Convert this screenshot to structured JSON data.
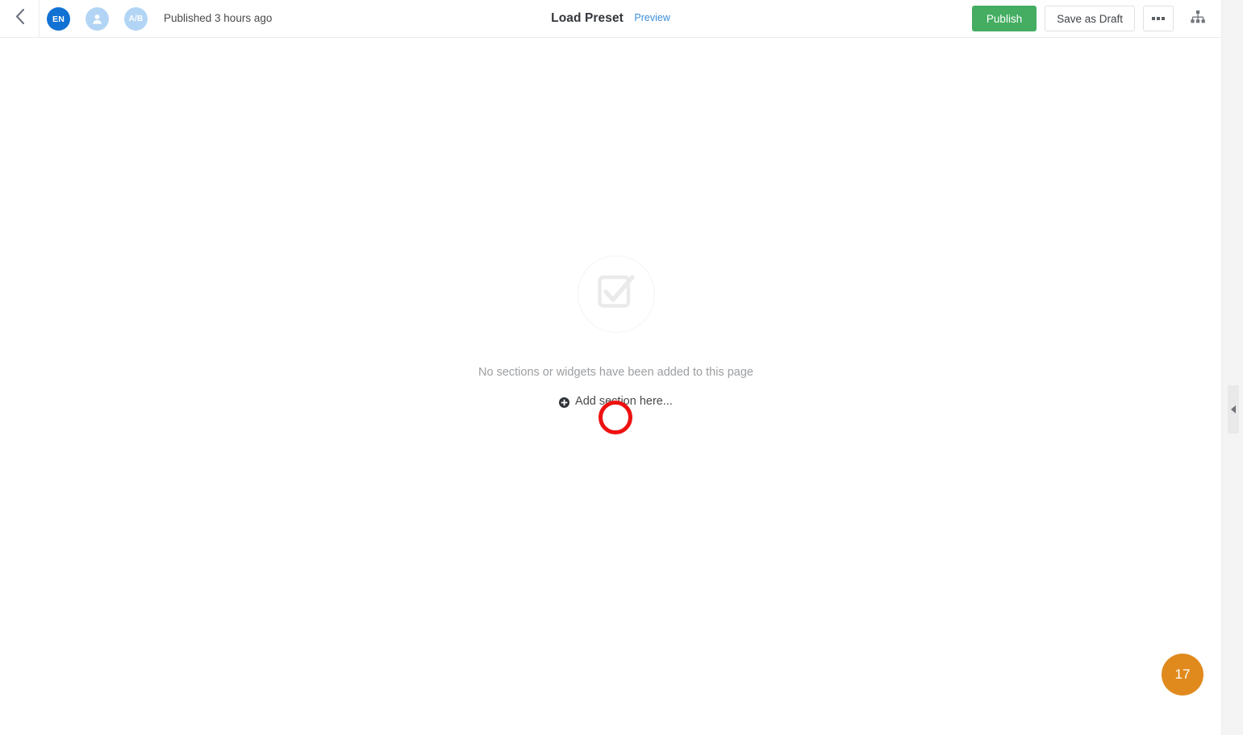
{
  "header": {
    "back_icon": "chevron-left-icon",
    "avatars": [
      {
        "name": "language-avatar",
        "label": "EN",
        "kind": "text"
      },
      {
        "name": "visitor-avatar",
        "label": "",
        "kind": "person-icon"
      },
      {
        "name": "ab-test-avatar",
        "label": "A/B",
        "kind": "text"
      }
    ],
    "status_text": "Published 3 hours ago",
    "title": "Load Preset",
    "preview_label": "Preview",
    "publish_label": "Publish",
    "save_draft_label": "Save as Draft",
    "more_icon": "ellipsis-icon",
    "sitemap_icon": "sitemap-icon"
  },
  "canvas": {
    "empty_icon": "checked-checkbox-icon",
    "empty_message": "No sections or widgets have been added to this page",
    "add_section_label": "Add section here...",
    "add_section_icon": "plus-circle-icon"
  },
  "annotation": {
    "ring_name": "red-highlight-ring",
    "ring_color": "#ee1111",
    "step_number": "17",
    "step_color": "#e08a1e"
  },
  "right_panel": {
    "expand_icon": "triangle-left-icon"
  },
  "colors": {
    "publish_green": "#44ad62",
    "link_blue": "#3d8ddb",
    "avatar_blue": "#1272d3",
    "avatar_light_blue": "#b3d5f5",
    "gutter_gray": "#f4f4f5"
  }
}
